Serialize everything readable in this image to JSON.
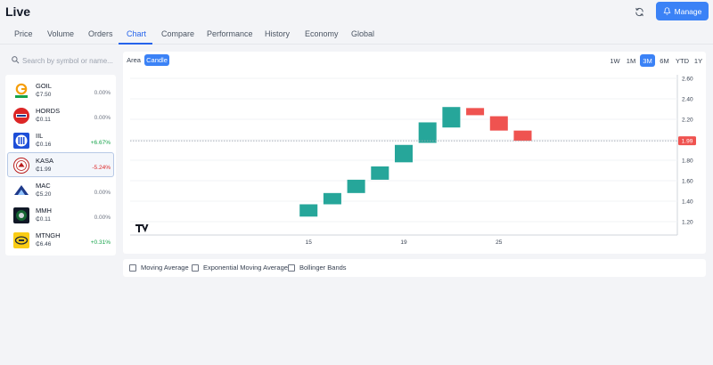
{
  "header": {
    "title": "Live",
    "manage_label": "Manage"
  },
  "tabs": [
    {
      "label": "Price"
    },
    {
      "label": "Volume"
    },
    {
      "label": "Orders"
    },
    {
      "label": "Chart"
    },
    {
      "label": "Compare"
    },
    {
      "label": "Performance"
    },
    {
      "label": "History"
    },
    {
      "label": "Economy"
    },
    {
      "label": "Global"
    }
  ],
  "active_tab": "Chart",
  "search": {
    "placeholder": "Search by symbol or name..."
  },
  "symbols": [
    {
      "symbol": "GOIL",
      "price": "₵7.50",
      "change": "0.00%",
      "trend": "flat"
    },
    {
      "symbol": "HORDS",
      "price": "₵0.11",
      "change": "0.00%",
      "trend": "flat"
    },
    {
      "symbol": "IIL",
      "price": "₵0.16",
      "change": "+6.67%",
      "trend": "up"
    },
    {
      "symbol": "KASA",
      "price": "₵1.99",
      "change": "-5.24%",
      "trend": "down"
    },
    {
      "symbol": "MAC",
      "price": "₵5.20",
      "change": "0.00%",
      "trend": "flat"
    },
    {
      "symbol": "MMH",
      "price": "₵0.11",
      "change": "0.00%",
      "trend": "flat"
    },
    {
      "symbol": "MTNGH",
      "price": "₵6.46",
      "change": "+0.31%",
      "trend": "up"
    }
  ],
  "selected_symbol": "KASA",
  "chart_controls": {
    "types": [
      "Area",
      "Candle"
    ],
    "active_type": "Candle",
    "ranges": [
      "1W",
      "1M",
      "3M",
      "6M",
      "YTD",
      "1Y"
    ],
    "active_range": "3M"
  },
  "chart_data": {
    "type": "candlestick",
    "y_ticks": [
      "2.60",
      "2.40",
      "2.20",
      "2.00",
      "1.80",
      "1.60",
      "1.40",
      "1.20"
    ],
    "ylim": [
      1.07,
      2.6
    ],
    "x_ticks": [
      {
        "label": "15",
        "day": 15
      },
      {
        "label": "19",
        "day": 19
      },
      {
        "label": "25",
        "day": 23
      }
    ],
    "xlim": [
      7.5,
      30.5
    ],
    "current_price": 1.99,
    "current_price_label": "1.99",
    "candles": [
      {
        "day": 15,
        "open": 1.25,
        "close": 1.37
      },
      {
        "day": 16,
        "open": 1.37,
        "close": 1.48
      },
      {
        "day": 17,
        "open": 1.48,
        "close": 1.61
      },
      {
        "day": 18,
        "open": 1.61,
        "close": 1.74
      },
      {
        "day": 19,
        "open": 1.78,
        "close": 1.95
      },
      {
        "day": 20,
        "open": 1.97,
        "close": 2.17
      },
      {
        "day": 21,
        "open": 2.12,
        "close": 2.32
      },
      {
        "day": 22,
        "open": 2.31,
        "close": 2.24
      },
      {
        "day": 23,
        "open": 2.23,
        "close": 2.09
      },
      {
        "day": 24,
        "open": 2.09,
        "close": 1.99
      }
    ],
    "up_color": "#26a69a",
    "down_color": "#ef5350",
    "price_label_color": "#ef5350"
  },
  "indicators": [
    {
      "label": "Moving Average"
    },
    {
      "label": "Exponential Moving Average"
    },
    {
      "label": "Bollinger Bands"
    }
  ],
  "colors": {
    "accent": "#3b82f6",
    "positive": "#16a34a",
    "negative": "#dc2626"
  },
  "icons": {
    "refresh": "refresh-icon",
    "manage": "bell-icon",
    "search": "search-icon",
    "watermark": "tradingview-logo"
  }
}
